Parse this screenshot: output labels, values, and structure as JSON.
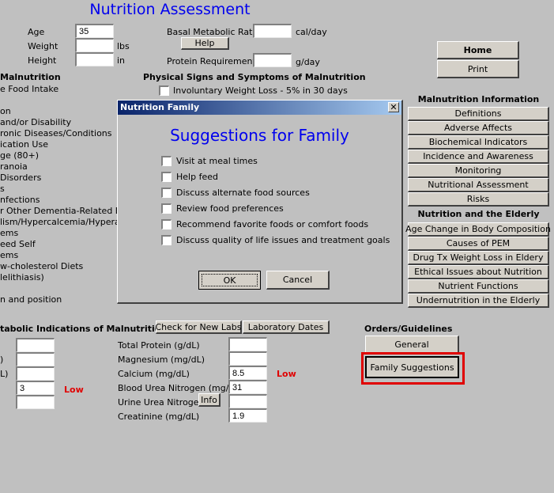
{
  "page": {
    "title": "Nutrition Assessment"
  },
  "demographics": {
    "age_label": "Age",
    "age_value": "35",
    "weight_label": "Weight",
    "weight_value": "",
    "weight_unit": "lbs",
    "height_label": "Height",
    "height_value": "",
    "height_unit": "in"
  },
  "metabolic": {
    "bmr_label": "Basal Metabolic Rate",
    "bmr_value": "",
    "bmr_unit": "cal/day",
    "help_label": "Help",
    "protein_label": "Protein Requirement",
    "protein_value": "",
    "protein_unit": "g/day"
  },
  "risk_section": {
    "heading": "Malnutrition",
    "items": [
      "e Food Intake",
      "",
      "on",
      " and/or Disability",
      "ronic Diseases/Conditions",
      "ication Use",
      "ge (80+)",
      "ranoia",
      "Disorders",
      "s",
      "nfections",
      "r Other Dementia-Related Beha",
      "lism/Hypercalcemia/Hyperadrer",
      "ems",
      "eed Self",
      "ems",
      "w-cholesterol Diets",
      "lelithiasis)",
      "",
      "n and position"
    ]
  },
  "physical_signs": {
    "heading": "Physical Signs and Symptoms of Malnutrition",
    "items": [
      {
        "label": "Involuntary Weight Loss - 5% in 30 days",
        "checked": false
      }
    ]
  },
  "dialog": {
    "window_title": "Nutrition Family",
    "heading": "Suggestions for Family",
    "close_glyph": "✕",
    "options": [
      {
        "label": "Visit at meal times",
        "checked": false
      },
      {
        "label": "Help feed",
        "checked": false
      },
      {
        "label": "Discuss alternate food sources",
        "checked": false
      },
      {
        "label": "Review food preferences",
        "checked": false
      },
      {
        "label": "Recommend favorite foods or comfort foods",
        "checked": false
      },
      {
        "label": "Discuss quality of life issues and treatment goals",
        "checked": false
      }
    ],
    "ok_label": "OK",
    "cancel_label": "Cancel"
  },
  "top_buttons": {
    "home": "Home",
    "print": "Print"
  },
  "malnutrition_info": {
    "heading": "Malnutrition Information",
    "items": [
      "Definitions",
      "Adverse Affects",
      "Biochemical Indicators",
      "Incidence and Awareness",
      "Monitoring",
      "Nutritional Assessment",
      "Risks"
    ]
  },
  "elderly": {
    "heading": "Nutrition and the Elderly",
    "items": [
      "Age Change in Body Composition",
      "Causes of PEM",
      "Drug Tx Weight Loss in Eldery",
      "Ethical Issues about Nutrition",
      "Nutrient Functions",
      "Undernutrition in the Elderly"
    ]
  },
  "labs": {
    "heading": "tabolic Indications of Malnutrition",
    "check_new_labs": "Check for New Labs",
    "lab_dates": "Laboratory Dates",
    "left_rows": [
      {
        "label": "",
        "value": "",
        "flag": ""
      },
      {
        "label": ")",
        "value": "",
        "flag": ""
      },
      {
        "label": "L)",
        "value": "",
        "flag": ""
      },
      {
        "label": "",
        "value": "3",
        "flag": "Low"
      },
      {
        "label": "",
        "value": "",
        "flag": ""
      }
    ],
    "right_rows": [
      {
        "label": "Total Protein (g/dL)",
        "value": "",
        "flag": ""
      },
      {
        "label": "Magnesium (mg/dL)",
        "value": "",
        "flag": ""
      },
      {
        "label": "Calcium (mg/dL)",
        "value": "8.5",
        "flag": "Low"
      },
      {
        "label": "Blood Urea Nitrogen (mg/dL)",
        "value": "31",
        "flag": ""
      },
      {
        "label": "Urine Urea Nitrogen",
        "value": "",
        "flag": ""
      },
      {
        "label": "Creatinine (mg/dL)",
        "value": "1.9",
        "flag": ""
      }
    ],
    "info_label": "Info"
  },
  "orders": {
    "heading": "Orders/Guidelines",
    "general": "General",
    "family_suggestions": "Family Suggestions"
  },
  "colors": {
    "title_blue": "#0000ee",
    "alert_red": "#e00000",
    "highlight_red": "#e00000"
  }
}
